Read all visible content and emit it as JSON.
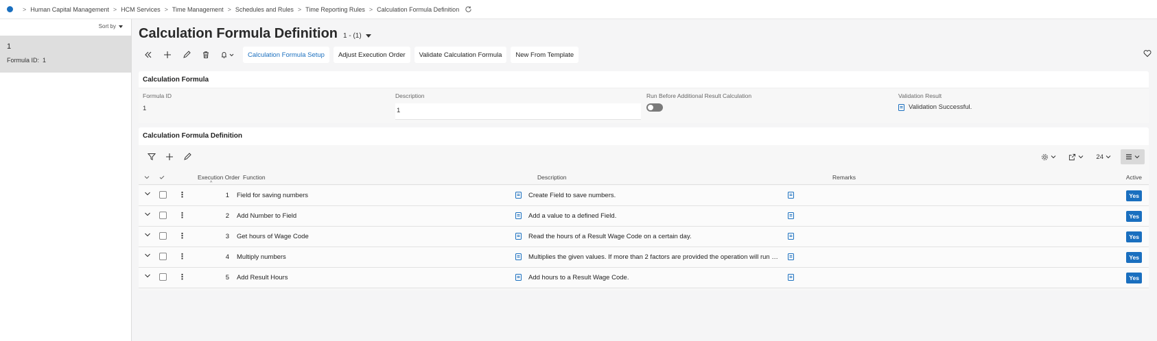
{
  "breadcrumb": {
    "items": [
      "Human Capital Management",
      "HCM Services",
      "Time Management",
      "Schedules and Rules",
      "Time Reporting Rules",
      "Calculation Formula Definition"
    ]
  },
  "left_panel": {
    "sort_label": "Sort by",
    "item": {
      "number": "1",
      "formula_id_label": "Formula ID:",
      "formula_id_value": "1"
    }
  },
  "page": {
    "title": "Calculation Formula Definition",
    "record_count": "1 - (1)"
  },
  "toolbar": {
    "buttons": [
      "Calculation Formula Setup",
      "Adjust Execution Order",
      "Validate Calculation Formula",
      "New From Template"
    ]
  },
  "calc_formula": {
    "section_title": "Calculation Formula",
    "formula_id_label": "Formula ID",
    "formula_id_value": "1",
    "description_label": "Description",
    "description_value": "1",
    "run_before_label": "Run Before Additional Result Calculation",
    "validation_label": "Validation Result",
    "validation_value": "Validation Successful."
  },
  "definition": {
    "section_title": "Calculation Formula Definition",
    "page_size": "24",
    "columns": {
      "execution_order": "Execution Order",
      "function": "Function",
      "description": "Description",
      "remarks": "Remarks",
      "active": "Active"
    },
    "rows": [
      {
        "order": "1",
        "function": "Field for saving numbers",
        "description": "Create Field to save numbers.",
        "active": "Yes"
      },
      {
        "order": "2",
        "function": "Add Number to Field",
        "description": "Add a value to a defined Field.",
        "active": "Yes"
      },
      {
        "order": "3",
        "function": "Get hours of Wage Code",
        "description": "Read the hours of a Result Wage Code on a certain day.",
        "active": "Yes"
      },
      {
        "order": "4",
        "function": "Multiply numbers",
        "description": "Multiplies the given values. If more than 2 factors are provided the operation will run step b...",
        "active": "Yes"
      },
      {
        "order": "5",
        "function": "Add Result Hours",
        "description": "Add hours to a Result Wage Code.",
        "active": "Yes"
      }
    ]
  },
  "colors": {
    "accent": "#1a6fbf",
    "selected": "#dedede",
    "background": "#f5f5f6"
  }
}
